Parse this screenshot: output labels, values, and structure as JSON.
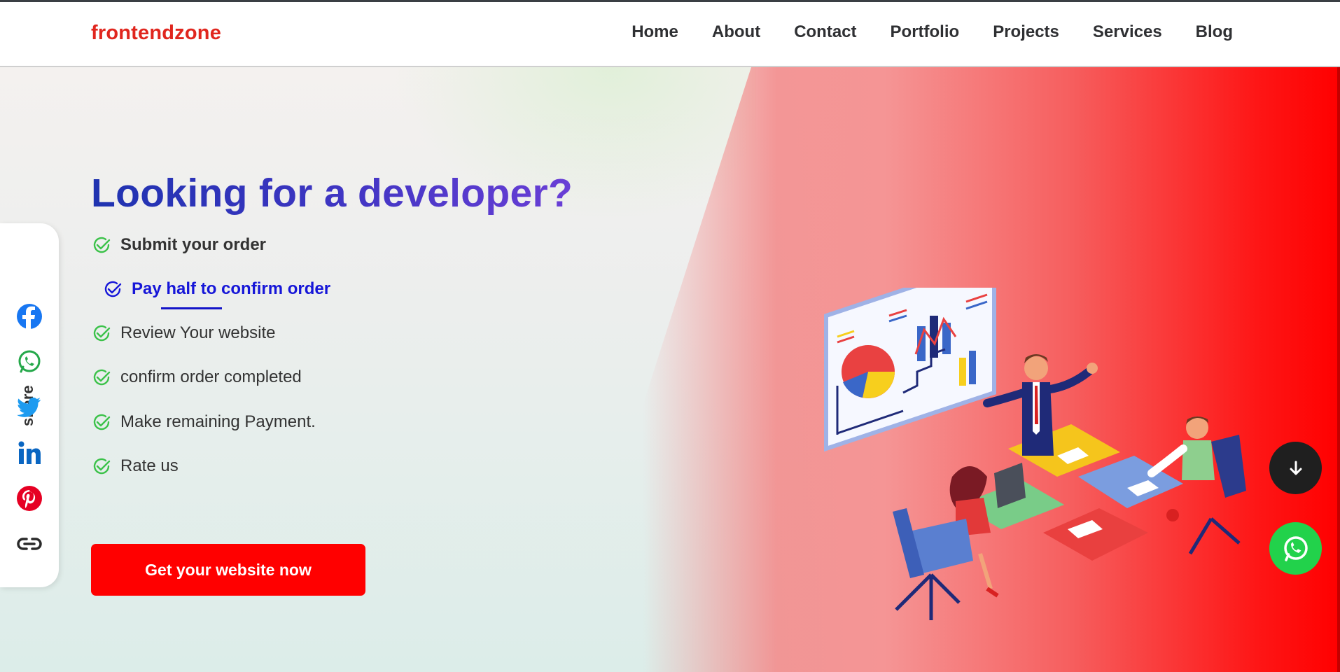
{
  "header": {
    "brand": "frontendzone",
    "nav": [
      "Home",
      "About",
      "Contact",
      "Portfolio",
      "Projects",
      "Services",
      "Blog"
    ]
  },
  "share": {
    "label": "share",
    "icons": [
      "facebook-icon",
      "whatsapp-icon",
      "twitter-icon",
      "linkedin-icon",
      "pinterest-icon",
      "link-icon"
    ]
  },
  "hero": {
    "headline": "Looking for a developer?",
    "steps": [
      "Submit your order",
      "Pay half to confirm order",
      "Review Your website",
      "confirm order completed",
      "Make remaining Payment.",
      "Rate us"
    ],
    "cta_label": "Get your website now"
  },
  "colors": {
    "brand": "#e0261e",
    "cta": "#ff0000",
    "active_step": "#1616d8",
    "check": "#3cc24a",
    "whatsapp_fab": "#22d24b"
  }
}
